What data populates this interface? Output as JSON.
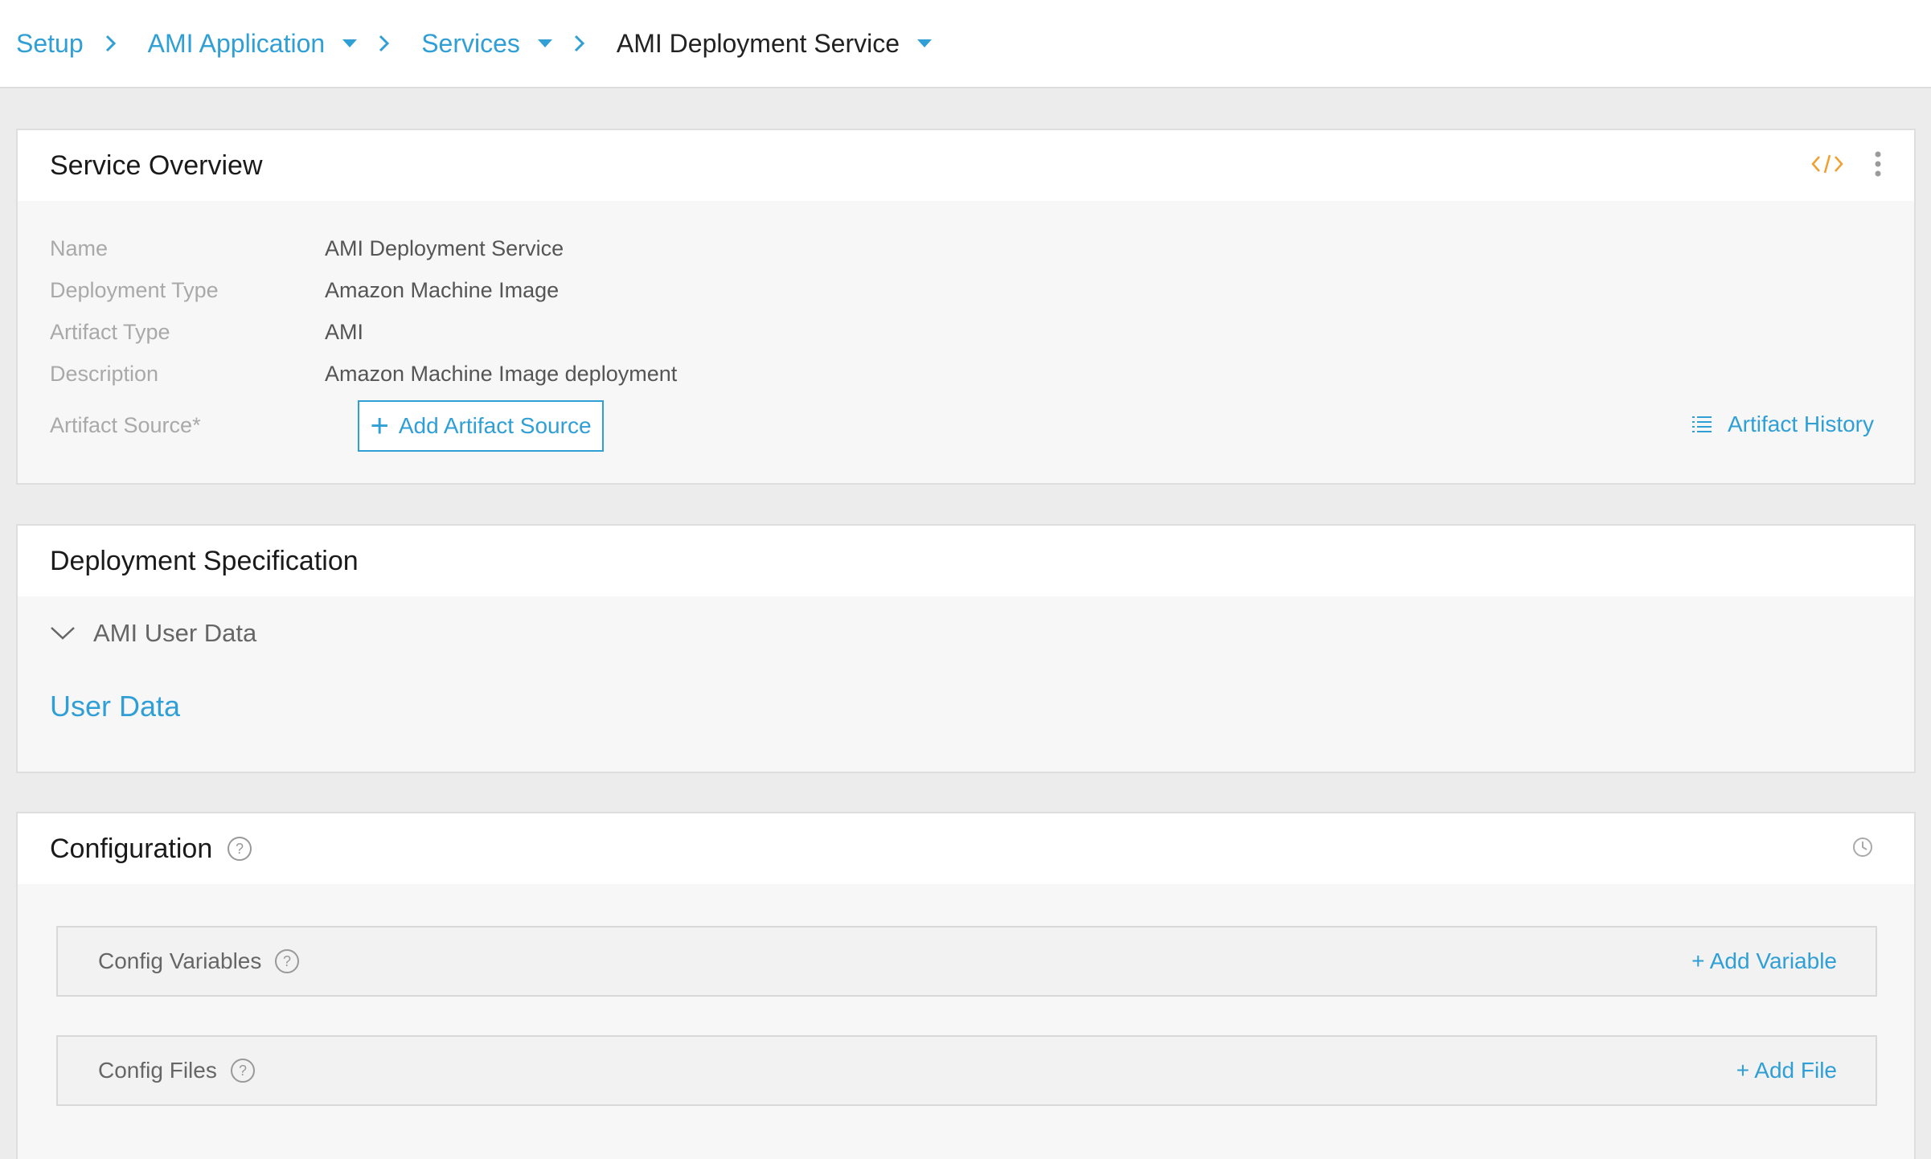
{
  "breadcrumb": {
    "setup": "Setup",
    "application": "AMI Application",
    "services": "Services",
    "current": "AMI Deployment Service"
  },
  "service_overview": {
    "title": "Service Overview",
    "fields": [
      {
        "label": "Name",
        "value": "AMI Deployment Service"
      },
      {
        "label": "Deployment Type",
        "value": "Amazon Machine Image"
      },
      {
        "label": "Artifact Type",
        "value": "AMI"
      },
      {
        "label": "Description",
        "value": "Amazon Machine Image deployment"
      }
    ],
    "artifact_source_label": "Artifact Source*",
    "add_artifact_source": "Add Artifact Source",
    "artifact_history": "Artifact History"
  },
  "deployment_spec": {
    "title": "Deployment Specification",
    "section": "AMI User Data",
    "user_data_link": "User Data"
  },
  "configuration": {
    "title": "Configuration",
    "config_variables": "Config Variables",
    "add_variable": "+ Add Variable",
    "config_files": "Config Files",
    "add_file": "+ Add File"
  },
  "colors": {
    "accent": "#2f9fd6",
    "yaml_icon": "#f0a030",
    "background": "#ececec"
  }
}
